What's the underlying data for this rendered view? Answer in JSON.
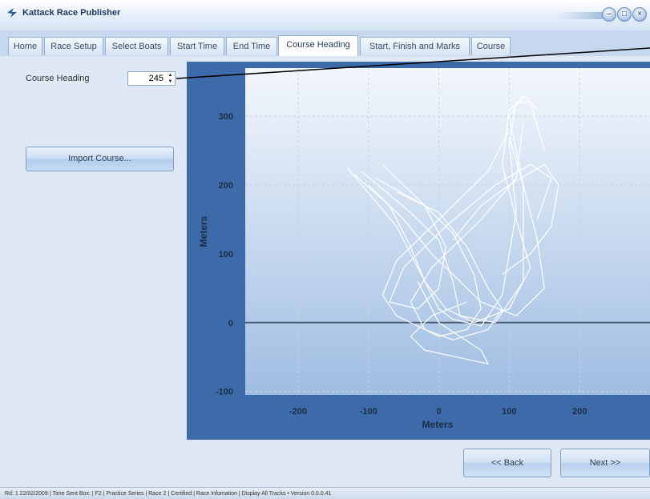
{
  "window": {
    "title": "Kattack Race Publisher",
    "minimize": "–",
    "maximize": "□",
    "close": "×"
  },
  "tabs": [
    "Home",
    "Race Setup",
    "Select Boats",
    "Start Time",
    "End Time",
    "Course Heading",
    "Start, Finish and Marks",
    "Course"
  ],
  "active_tab": "Course Heading",
  "left_panel": {
    "course_heading_label": "Course Heading",
    "course_heading_value": "245",
    "import_button": "Import Course..."
  },
  "chart_data": {
    "type": "line",
    "description_of_marks": "white GPS boat tracks",
    "xlabel": "Meters",
    "ylabel": "Meters",
    "xlim": [
      -275,
      300
    ],
    "ylim": [
      -105,
      370
    ],
    "x_ticks": [
      -200,
      -100,
      0,
      100,
      200
    ],
    "y_ticks": [
      -100,
      0,
      100,
      200,
      300
    ],
    "grid": true,
    "zero_line_y": 0,
    "series": [
      {
        "values": [
          [
            -130,
            225
          ],
          [
            -60,
            140
          ],
          [
            -20,
            60
          ],
          [
            0,
            20
          ],
          [
            20,
            5
          ],
          [
            60,
            -5
          ],
          [
            90,
            40
          ],
          [
            110,
            160
          ],
          [
            100,
            260
          ],
          [
            110,
            320
          ],
          [
            130,
            320
          ],
          [
            150,
            250
          ]
        ]
      },
      {
        "values": [
          [
            -110,
            220
          ],
          [
            -40,
            160
          ],
          [
            0,
            120
          ],
          [
            20,
            60
          ],
          [
            30,
            10
          ],
          [
            80,
            0
          ],
          [
            120,
            60
          ],
          [
            120,
            200
          ],
          [
            100,
            300
          ],
          [
            120,
            330
          ],
          [
            140,
            310
          ]
        ]
      },
      {
        "values": [
          [
            -80,
            230
          ],
          [
            -30,
            180
          ],
          [
            20,
            130
          ],
          [
            50,
            70
          ],
          [
            60,
            20
          ],
          [
            40,
            -10
          ],
          [
            0,
            -20
          ],
          [
            -60,
            10
          ],
          [
            -80,
            40
          ],
          [
            -60,
            90
          ],
          [
            0,
            150
          ],
          [
            70,
            220
          ],
          [
            100,
            280
          ]
        ]
      },
      {
        "values": [
          [
            -100,
            200
          ],
          [
            -50,
            150
          ],
          [
            -10,
            100
          ],
          [
            30,
            60
          ],
          [
            60,
            30
          ],
          [
            110,
            10
          ],
          [
            150,
            50
          ],
          [
            140,
            120
          ],
          [
            120,
            200
          ],
          [
            100,
            270
          ]
        ]
      },
      {
        "values": [
          [
            -90,
            210
          ],
          [
            -20,
            170
          ],
          [
            10,
            110
          ],
          [
            0,
            50
          ],
          [
            -30,
            20
          ],
          [
            -70,
            30
          ],
          [
            -50,
            80
          ],
          [
            10,
            140
          ],
          [
            80,
            200
          ],
          [
            130,
            230
          ],
          [
            160,
            210
          ],
          [
            140,
            150
          ]
        ]
      },
      {
        "values": [
          [
            -60,
            190
          ],
          [
            0,
            160
          ],
          [
            40,
            110
          ],
          [
            70,
            50
          ],
          [
            90,
            20
          ],
          [
            70,
            -10
          ],
          [
            20,
            -25
          ],
          [
            -20,
            -10
          ],
          [
            -40,
            30
          ],
          [
            -10,
            80
          ],
          [
            60,
            150
          ],
          [
            110,
            210
          ],
          [
            120,
            290
          ]
        ]
      },
      {
        "values": [
          [
            -120,
            215
          ],
          [
            -70,
            170
          ],
          [
            -40,
            110
          ],
          [
            -20,
            60
          ],
          [
            10,
            20
          ],
          [
            50,
            0
          ],
          [
            100,
            20
          ],
          [
            130,
            80
          ],
          [
            110,
            150
          ],
          [
            90,
            230
          ],
          [
            100,
            310
          ],
          [
            120,
            325
          ]
        ]
      },
      {
        "values": [
          [
            -30,
            60
          ],
          [
            0,
            0
          ],
          [
            30,
            -20
          ],
          [
            60,
            -40
          ],
          [
            70,
            -60
          ],
          [
            -20,
            -40
          ],
          [
            -40,
            -20
          ],
          [
            -10,
            10
          ],
          [
            40,
            30
          ]
        ]
      },
      {
        "values": [
          [
            20,
            120
          ],
          [
            60,
            170
          ],
          [
            100,
            200
          ],
          [
            150,
            230
          ],
          [
            170,
            200
          ],
          [
            160,
            140
          ],
          [
            130,
            100
          ],
          [
            90,
            70
          ]
        ]
      }
    ]
  },
  "buttons": {
    "back": "<< Back",
    "next": "Next >>"
  },
  "status_bar": "Rd: 1 22/02/2009 | Time Sent Box: | F2 | Practice Series | Race 2 | Certified | Race Infomation | Display All Tracks • Version 0.0.0.41"
}
